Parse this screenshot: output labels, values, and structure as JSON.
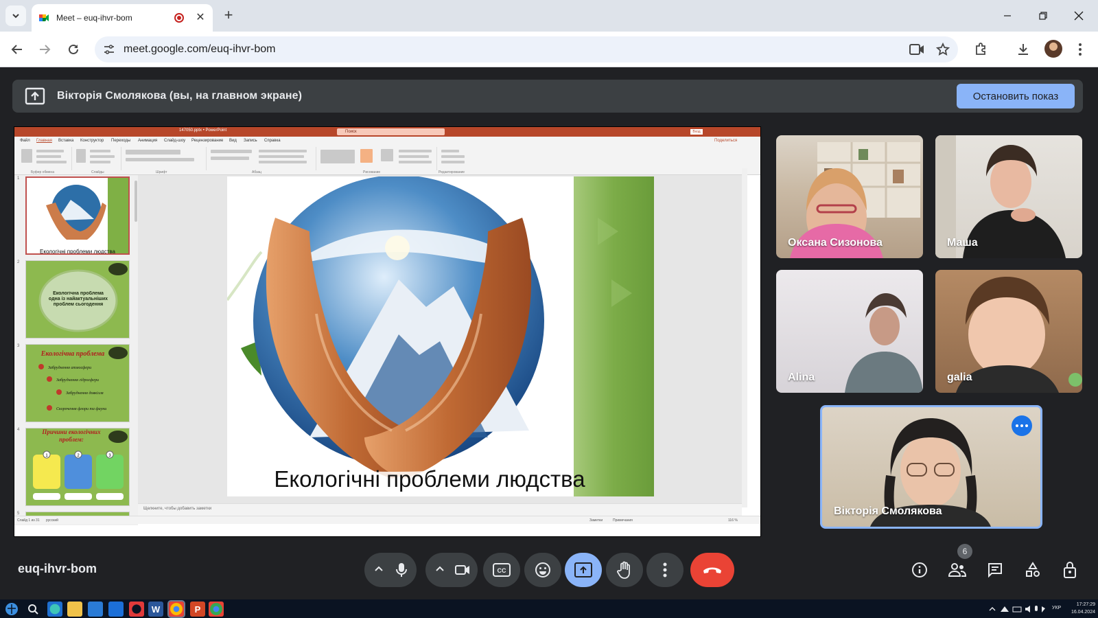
{
  "browser": {
    "tab_title": "Meet – euq-ihvr-bom",
    "url": "meet.google.com/euq-ihvr-bom"
  },
  "presentation_banner": {
    "text": "Вікторія Смолякова (вы, на главном экране)",
    "stop_button": "Остановить показ"
  },
  "shared_screen": {
    "app_file_title": "147050.pptx • PowerPoint",
    "search_placeholder": "Поиск",
    "signin": "Вход",
    "share": "Поделиться",
    "menu": [
      "Файл",
      "Главная",
      "Вставка",
      "Конструктор",
      "Переходы",
      "Анимация",
      "Слайд-шоу",
      "Рецензирование",
      "Вид",
      "Запись",
      "Справка"
    ],
    "ribbon_groups": [
      "Буфер обмена",
      "Слайды",
      "Шрифт",
      "Абзац",
      "Рисование",
      "Редактирование"
    ],
    "thumbnails": [
      {
        "num": "1",
        "caption": "Екологічні проблеми людства"
      },
      {
        "num": "2",
        "caption": "Екологічна проблема одна із найактуальніших проблем сьогодення"
      },
      {
        "num": "3",
        "caption": "Екологічна проблема",
        "items": [
          "Забруднення атмосфери",
          "Забруднення гідросфери",
          "Забруднення довкілля",
          "Скорочення флори та фауни"
        ]
      },
      {
        "num": "4",
        "caption": "Причини екологічних проблем:",
        "items": [
          "1",
          "2",
          "3"
        ]
      },
      {
        "num": "5",
        "caption": ""
      }
    ],
    "slide_title": "Екологічні проблеми людства",
    "notes_placeholder": "Щелкните, чтобы добавить заметки",
    "status_left": "Слайд 1 из 31",
    "status_lang": "русский",
    "status_notes": "Заметки",
    "status_comments": "Примечания",
    "zoom": "116 %"
  },
  "participants": [
    {
      "name": "Оксана Сизонова"
    },
    {
      "name": "Маша"
    },
    {
      "name": "Alina"
    },
    {
      "name": "galia"
    },
    {
      "name": "Вікторія Смолякова"
    }
  ],
  "bottom_bar": {
    "meeting_code": "euq-ihvr-bom",
    "people_count": "6"
  },
  "taskbar": {
    "language": "УКР",
    "time": "17:27:29",
    "date": "16.04.2024"
  },
  "colors": {
    "meet_bg": "#202124",
    "accent_blue": "#8ab4f8",
    "leave_red": "#ea4335",
    "ppt_red": "#b7472a"
  }
}
